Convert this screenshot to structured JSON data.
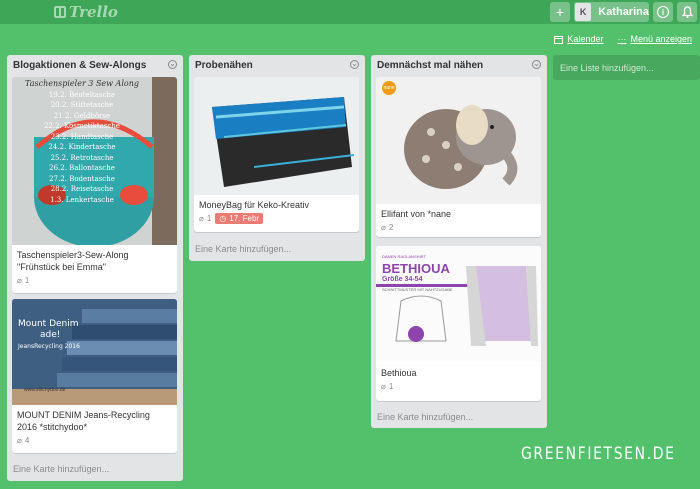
{
  "header": {
    "logo_text": "Trello",
    "add_symbol": "+",
    "user_initial": "K",
    "user_name": "Katharina",
    "info_symbol": "i",
    "bell_symbol": "🔔"
  },
  "board_menu": {
    "calendar_label": "Kalender",
    "show_menu_label": "Menü anzeigen"
  },
  "lists": [
    {
      "title": "Blogaktionen & Sew-Alongs",
      "cards": [
        {
          "title": "Taschenspieler3-Sew-Along \"Frühstück bei Emma\"",
          "attachments": "1",
          "cover_text": [
            "Taschenspieler 3 Sew Along",
            "19.2. Beuteltasche",
            "20.2. Stiftetasche",
            "21.2. Geldbörse",
            "22.2. Kosmetiktasche",
            "23.2. Handtasche",
            "24.2. Kindertasche",
            "25.2. Retrotasche",
            "26.2. Ballontasche",
            "27.2. Bodentasche",
            "28.2. Reisetasche",
            "1.3. Lenkertasche"
          ]
        },
        {
          "title": "MOUNT DENIM Jeans-Recycling 2016 *stitchydoo*",
          "attachments": "4",
          "cover_text": [
            "Mount Denim",
            "ade!",
            "JeansRecycling 2016",
            "www.stitchydoo.de"
          ]
        }
      ],
      "add_card": "Eine Karte hinzufügen..."
    },
    {
      "title": "Probenähen",
      "cards": [
        {
          "title": "MoneyBag für Keko-Kreativ",
          "attachments": "1",
          "due": "17. Febr"
        }
      ],
      "add_card": "Eine Karte hinzufügen..."
    },
    {
      "title": "Demnächst mal nähen",
      "cards": [
        {
          "title": "Ellifant von *nane",
          "attachments": "2",
          "cover_badge": "nane"
        },
        {
          "title": "Bethioua",
          "attachments": "1",
          "cover_text": [
            "DAMEN RAGLANSHIRT",
            "BETHIOUA",
            "Größe 34-54",
            "SCHNITTMUSTER MIT NAHTZUGABE"
          ]
        }
      ],
      "add_card": "Eine Karte hinzufügen..."
    }
  ],
  "add_list": "Eine Liste hinzufügen...",
  "watermark": "GREENFIETSEN.DE"
}
